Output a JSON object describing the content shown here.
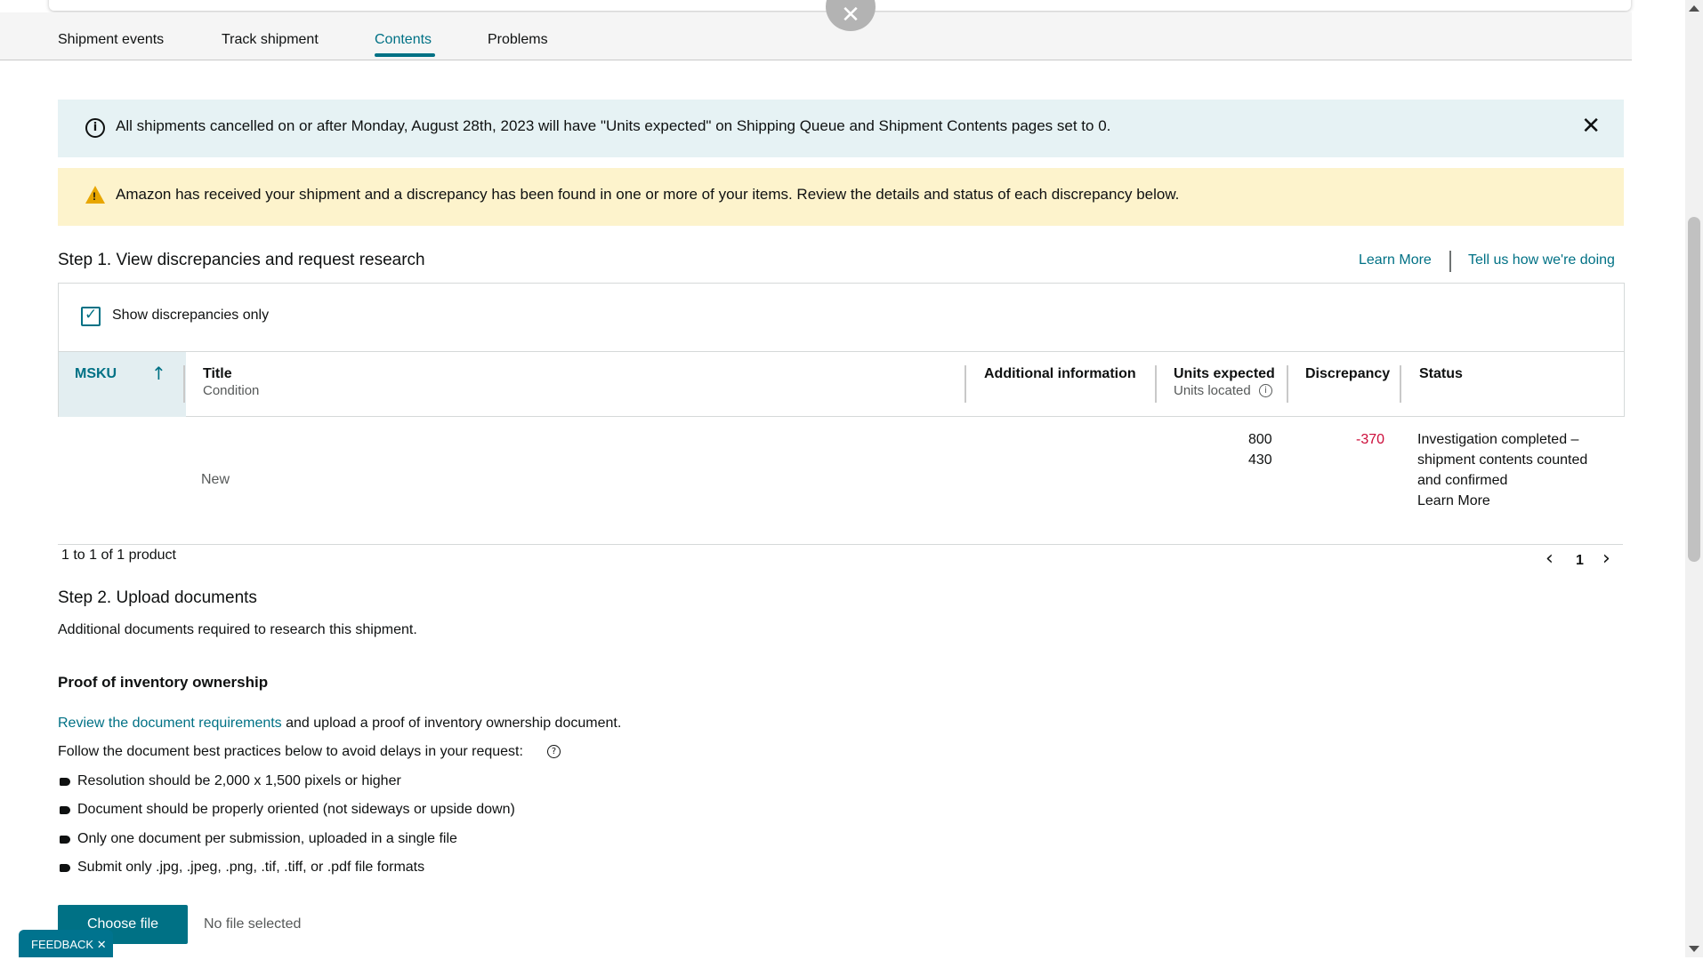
{
  "tabs": [
    {
      "label": "Shipment events"
    },
    {
      "label": "Track shipment"
    },
    {
      "label": "Contents"
    },
    {
      "label": "Problems"
    }
  ],
  "active_tab": "Contents",
  "info_banner": {
    "text": "All shipments cancelled on or after Monday, August 28th, 2023 will have \"Units expected\" on Shipping Queue and Shipment Contents pages set to 0."
  },
  "warning_banner": {
    "text": "Amazon has received your shipment and a discrepancy has been found in one or more of your items. Review the details and status of each discrepancy below."
  },
  "step1": {
    "title": "Step 1. View discrepancies and request research",
    "learn_more": "Learn More",
    "feedback_link": "Tell us how we're doing",
    "filter_checkbox_label": "Show discrepancies only",
    "filter_checked": true,
    "columns": {
      "msku": "MSKU",
      "title": "Title",
      "title_sub": "Condition",
      "additional": "Additional information",
      "units_expected": "Units expected",
      "units_located": "Units located",
      "discrepancy": "Discrepancy",
      "status": "Status"
    },
    "rows": [
      {
        "condition": "New",
        "units_expected": "800",
        "units_located": "430",
        "discrepancy": "-370",
        "status_line1": "Investigation completed –",
        "status_line2": "shipment contents counted",
        "status_line3": "and confirmed",
        "status_link": "Learn More"
      }
    ],
    "pagination_summary": "1 to 1 of 1 product",
    "current_page": "1"
  },
  "step2": {
    "title": "Step 2. Upload documents",
    "description": "Additional documents required to research this shipment.",
    "proof_heading": "Proof of inventory ownership",
    "requirements_link": "Review the document requirements",
    "requirements_suffix": " and upload a proof of inventory ownership document.",
    "best_practices_intro": "Follow the document best practices below to avoid delays in your request:",
    "best_practices": [
      "Resolution should be 2,000 x 1,500 pixels or higher",
      "Document should be properly oriented (not sideways or upside down)",
      "Only one document per submission, uploaded in a single file",
      "Submit only .jpg, .jpeg, .png, .tif, .tiff, or .pdf file formats"
    ],
    "choose_file_label": "Choose file",
    "no_file_text": "No file selected"
  },
  "feedback_tab": {
    "label": "FEEDBACK"
  },
  "colors": {
    "link": "#007185",
    "discrepancy": "#cc0c39",
    "info_bg": "#e6f2f4",
    "warn_bg": "#fdf3cc",
    "button": "#007185"
  }
}
